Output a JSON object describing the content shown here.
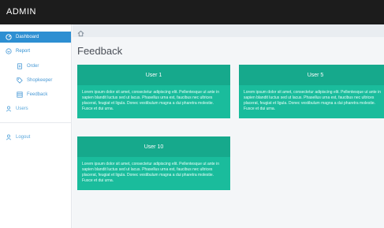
{
  "header": {
    "brand": "ADMIN"
  },
  "sidebar": {
    "items": [
      {
        "label": "Dashboard",
        "icon": "dashboard-icon"
      },
      {
        "label": "Report",
        "icon": "report-icon"
      },
      {
        "label": "Order",
        "icon": "order-icon"
      },
      {
        "label": "Shopkeeper",
        "icon": "tag-icon"
      },
      {
        "label": "Feedback",
        "icon": "feedback-icon"
      },
      {
        "label": "Users",
        "icon": "user-icon"
      },
      {
        "label": "Logout",
        "icon": "logout-icon"
      }
    ]
  },
  "breadcrumb": {
    "icon": "home-icon"
  },
  "page": {
    "title": "Feedback"
  },
  "cards": [
    {
      "user": "User 1",
      "text": "Lorem ipsum dolor sit amet, consectetur adipiscing elit. Pellentesque ut ante in sapien blandit luctus sed ut lacus. Phasellus urna est, faucibus nec ultrices placerat, feugiat et ligula. Donec vestibulum magna a dui pharetra molestie. Fusce et dui urna."
    },
    {
      "user": "User 5",
      "text": "Lorem ipsum dolor sit amet, consectetur adipiscing elit. Pellentesque ut ante in sapien blandit luctus sed ut lacus. Phasellus urna est, faucibus nec ultrices placerat, feugiat et ligula. Donec vestibulum magna a dui pharetra molestie. Fusce et dui urna."
    },
    {
      "user": "User 10",
      "text": "Lorem ipsum dolor sit amet, consectetur adipiscing elit. Pellentesque ut ante in sapien blandit luctus sed ut lacus. Phasellus urna est, faucibus nec ultrices placerat, feugiat et ligula. Donec vestibulum magna a dui pharetra molestie. Fusce et dui urna."
    }
  ],
  "colors": {
    "accent": "#2d8fd2",
    "card": "#1abc9c",
    "card_header": "#16a98c",
    "topbar": "#1c1c1c"
  }
}
